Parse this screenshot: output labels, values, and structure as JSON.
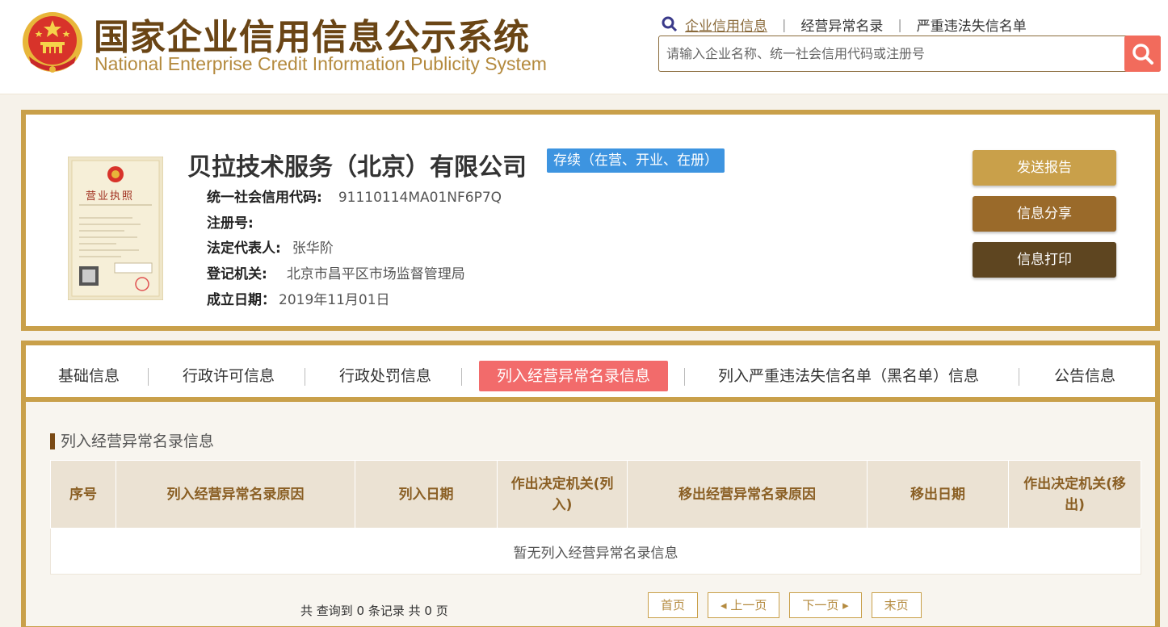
{
  "header": {
    "brand_cn": "国家企业信用信息公示系统",
    "brand_en": "National Enterprise Credit Information Publicity System",
    "nav": [
      {
        "label": "企业信用信息"
      },
      {
        "label": "经营异常名录"
      },
      {
        "label": "严重违法失信名单"
      }
    ],
    "search_placeholder": "请输入企业名称、统一社会信用代码或注册号"
  },
  "company": {
    "name": "贝拉技术服务（北京）有限公司",
    "status": "存续（在营、开业、在册）",
    "license_title": "营业执照",
    "fields": [
      {
        "label": "统一社会信用代码:",
        "value": "91110114MA01NF6P7Q"
      },
      {
        "label": "注册号:",
        "value": ""
      },
      {
        "label": "法定代表人:",
        "value": "张华阶"
      },
      {
        "label": "登记机关:",
        "value": "北京市昌平区市场监督管理局"
      },
      {
        "label": "成立日期：",
        "value": "2019年11月01日"
      }
    ],
    "buttons": {
      "send": "发送报告",
      "share": "信息分享",
      "print": "信息打印"
    }
  },
  "tabs": [
    {
      "label": "基础信息"
    },
    {
      "label": "行政许可信息"
    },
    {
      "label": "行政处罚信息"
    },
    {
      "label": "列入经营异常名录信息"
    },
    {
      "label": "列入严重违法失信名单（黑名单）信息"
    },
    {
      "label": "公告信息"
    }
  ],
  "section": {
    "title": "列入经营异常名录信息",
    "columns": [
      "序号",
      "列入经营异常名录原因",
      "列入日期",
      "作出决定机关(列入)",
      "移出经营异常名录原因",
      "移出日期",
      "作出决定机关(移出)"
    ],
    "empty_text": "暂无列入经营异常名录信息",
    "record_count": "共 查询到 0 条记录 共 0 页"
  },
  "pager": {
    "first": "首页",
    "prev": "◂ 上一页",
    "next": "下一页 ▸",
    "last": "末页"
  },
  "colors": {
    "brand_brown": "#6a4515",
    "gold": "#c9a04a",
    "active_tab": "#f26b6b",
    "status_blue": "#3d94e0",
    "search_red": "#f26b5c"
  }
}
